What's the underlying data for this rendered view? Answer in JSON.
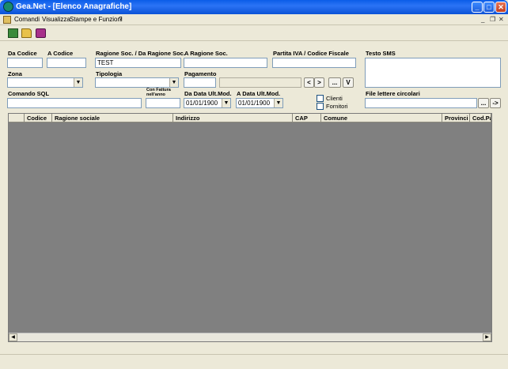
{
  "window": {
    "title": "Gea.Net - [Elenco Anagrafiche]"
  },
  "titlebar_buttons": {
    "minimize": "_",
    "maximize": "□",
    "close": "✕"
  },
  "menu": {
    "items": [
      "Comandi",
      "Visualizza",
      "Stampe e Funzioni",
      "?"
    ]
  },
  "mdi_buttons": {
    "minimize": "_",
    "restore": "❐",
    "close": "✕"
  },
  "filters": {
    "da_codice": {
      "label": "Da Codice",
      "value": ""
    },
    "a_codice": {
      "label": "A Codice",
      "value": ""
    },
    "ragione_soc": {
      "label": "Ragione Soc. / Da Ragione Soc.",
      "value": "TEST"
    },
    "a_ragione_soc": {
      "label": "A Ragione Soc.",
      "value": ""
    },
    "partita_iva": {
      "label": "Partita IVA / Codice Fiscale",
      "value": ""
    },
    "testo_sms": {
      "label": "Testo SMS",
      "value": ""
    },
    "zona": {
      "label": "Zona",
      "value": ""
    },
    "tipologia": {
      "label": "Tipologia",
      "value": ""
    },
    "pagamento": {
      "label": "Pagamento",
      "value": "",
      "desc": ""
    },
    "nav_prev": "<",
    "nav_next": ">",
    "nav_more": "...",
    "nav_v": "V",
    "comando_sql": {
      "label": "Comando SQL",
      "value": ""
    },
    "con_fattura": {
      "label": "Con Fattura nell'anno",
      "value": ""
    },
    "da_data": {
      "label": "Da Data Ult.Mod.",
      "value": "01/01/1900"
    },
    "a_data": {
      "label": "A Data Ult.Mod.",
      "value": "01/01/1900"
    },
    "clienti": {
      "label": "Clienti",
      "checked": false
    },
    "fornitori": {
      "label": "Fornitori",
      "checked": false
    },
    "file_lettere": {
      "label": "File lettere circolari",
      "value": "",
      "browse": "...",
      "go": "->"
    }
  },
  "grid": {
    "columns": [
      "Codice",
      "Ragione sociale",
      "Indirizzo",
      "CAP",
      "Comune",
      "Provinci",
      "Cod.Pa"
    ],
    "rows": []
  },
  "colors": {
    "titlebar": "#0a5de8",
    "grid_bg": "#808080",
    "window_bg": "#ece9d8"
  }
}
